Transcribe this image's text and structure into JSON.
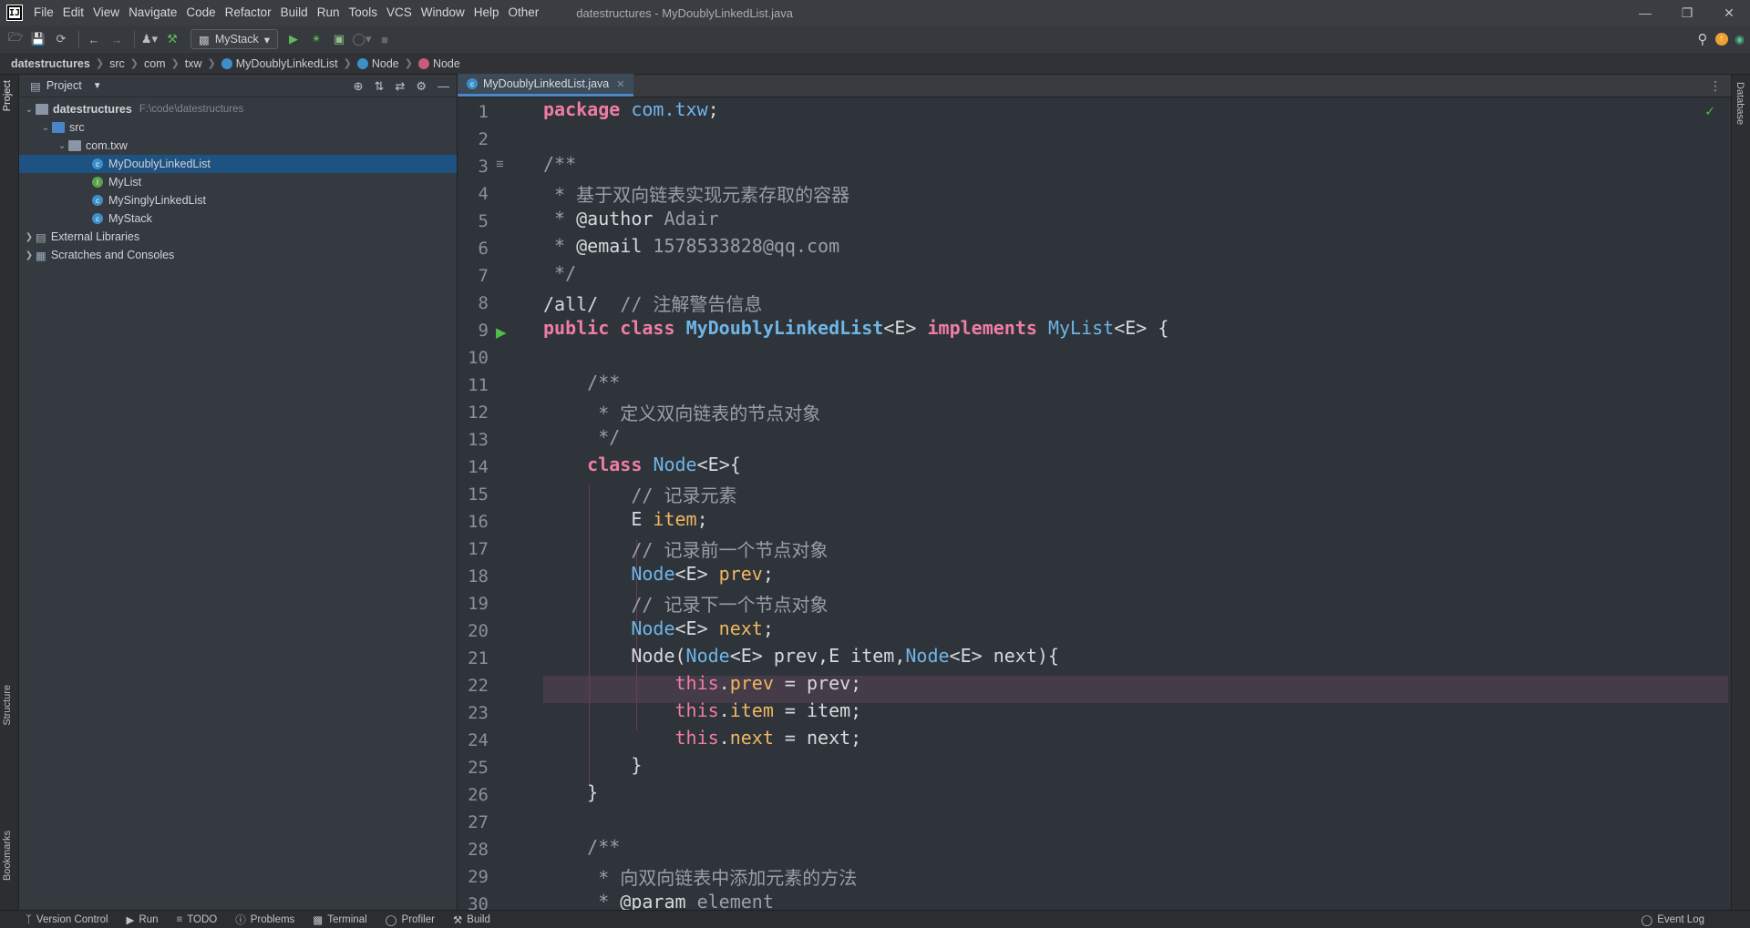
{
  "app": {
    "window_title": "datestructures - MyDoublyLinkedList.java",
    "menu": [
      "File",
      "Edit",
      "View",
      "Navigate",
      "Code",
      "Refactor",
      "Build",
      "Run",
      "Tools",
      "VCS",
      "Window",
      "Help",
      "Other"
    ]
  },
  "toolbar": {
    "run_config": "MyStack"
  },
  "breadcrumb": [
    "datestructures",
    "src",
    "com",
    "txw",
    "MyDoublyLinkedList",
    "Node",
    "Node"
  ],
  "left_stripe": {
    "project": "Project",
    "structure": "Structure",
    "bookmarks": "Bookmarks"
  },
  "right_stripe": {
    "database": "Database"
  },
  "project_panel": {
    "title": "Project",
    "tree": [
      {
        "label": "datestructures",
        "path": "F:\\code\\datestructures"
      },
      {
        "label": "src"
      },
      {
        "label": "com.txw"
      },
      {
        "label": "MyDoublyLinkedList"
      },
      {
        "label": "MyList"
      },
      {
        "label": "MySinglyLinkedList"
      },
      {
        "label": "MyStack"
      },
      {
        "label": "External Libraries"
      },
      {
        "label": "Scratches and Consoles"
      }
    ]
  },
  "editor": {
    "tab": "MyDoublyLinkedList.java",
    "line_numbers": [
      "1",
      "2",
      "3",
      "4",
      "5",
      "6",
      "7",
      "8",
      "9",
      "10",
      "11",
      "12",
      "13",
      "14",
      "15",
      "16",
      "17",
      "18",
      "19",
      "20",
      "21",
      "22",
      "23",
      "24",
      "25",
      "26",
      "27",
      "28",
      "29",
      "30"
    ]
  },
  "status": {
    "items": [
      "Version Control",
      "Run",
      "TODO",
      "Problems",
      "Terminal",
      "Profiler",
      "Build"
    ],
    "event_log": "Event Log"
  }
}
